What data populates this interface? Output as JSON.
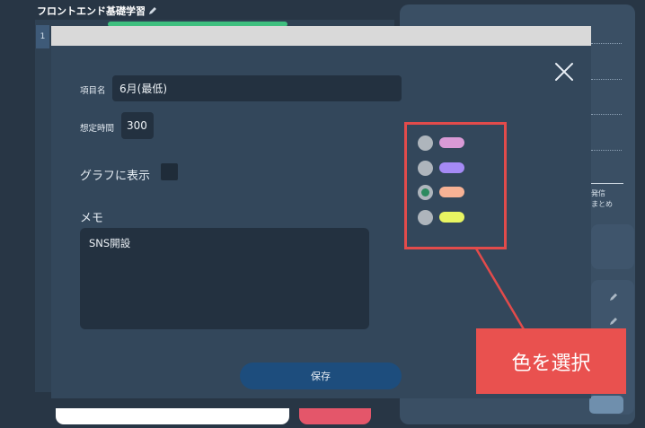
{
  "board": {
    "title": "フロントエンド基礎学習",
    "row_number": "1",
    "right_panel_text_line1": "発信",
    "right_panel_text_line2": "まとめ"
  },
  "modal": {
    "item_name_label": "項目名",
    "item_name_value": "6月(最低)",
    "expected_time_label": "想定時間",
    "expected_time_value": "300",
    "show_in_graph_label": "グラフに表示",
    "show_in_graph_checked": false,
    "memo_label": "メモ",
    "memo_value": "SNS開設",
    "save_label": "保存"
  },
  "colors": {
    "options": [
      {
        "color": "#d99ad6",
        "selected": false
      },
      {
        "color": "#a58af5",
        "selected": false
      },
      {
        "color": "#f7b295",
        "selected": true
      },
      {
        "color": "#e8f562",
        "selected": false
      }
    ],
    "highlight_color": "#e24b4b"
  },
  "callout": {
    "text": "色を選択"
  }
}
